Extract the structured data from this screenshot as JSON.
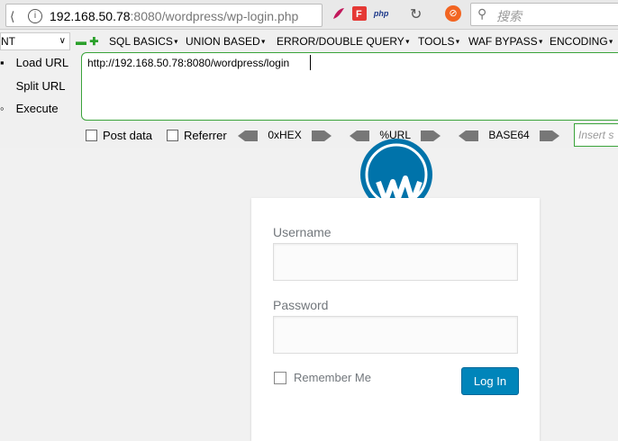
{
  "browser": {
    "url_host": "192.168.50.78",
    "url_rest": ":8080/wordpress/wp-login.php",
    "search_placeholder": "搜索",
    "php_badge": "php"
  },
  "hackbar": {
    "select_value": "NT",
    "menus": [
      "SQL BASICS",
      "UNION BASED",
      "ERROR/DOUBLE QUERY",
      "TOOLS",
      "WAF BYPASS",
      "ENCODING"
    ],
    "load_url": "Load URL",
    "split_url": "Split URL",
    "execute": "Execute",
    "url_value": "http://192.168.50.78:8080/wordpress/login",
    "post_data": "Post data",
    "referrer": "Referrer",
    "hex": "0xHEX",
    "url_enc": "%URL",
    "base64": "BASE64",
    "insert_placeholder": "Insert s"
  },
  "login": {
    "username_label": "Username",
    "password_label": "Password",
    "remember_label": "Remember Me",
    "login_button": "Log In",
    "accent": "#0085ba"
  }
}
